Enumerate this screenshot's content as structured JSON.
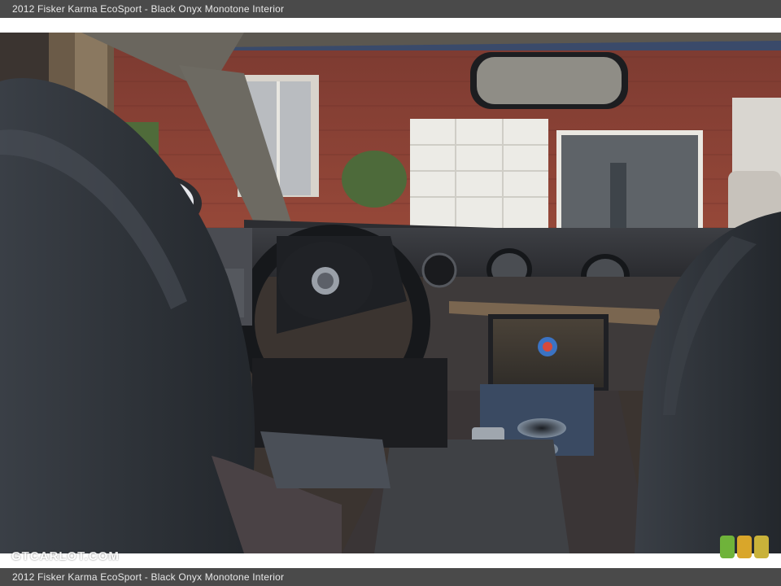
{
  "header": {
    "caption": "2012 Fisker Karma EcoSport - Black Onyx Monotone Interior"
  },
  "footer": {
    "caption": "2012 Fisker Karma EcoSport - Black Onyx Monotone Interior"
  },
  "watermark": {
    "text": "GTCARLOT.COM"
  },
  "colors": {
    "bar": "#4a4a4a",
    "bar_text": "#e8e8e8",
    "brick": "#8a3f33",
    "leather": "#2b2f35",
    "badge_colors": [
      "#6fb33a",
      "#d9a62a",
      "#c9b23a"
    ]
  }
}
